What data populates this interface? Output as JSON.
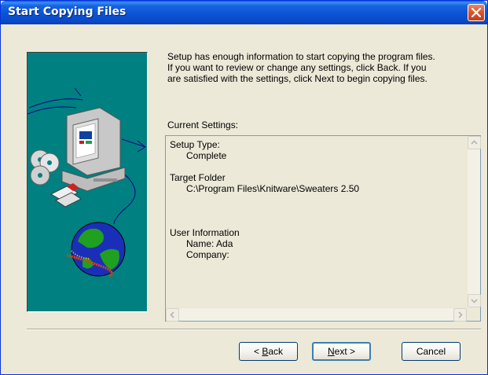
{
  "window": {
    "title": "Start Copying Files"
  },
  "intro": {
    "line1": "Setup has enough information to start copying the program files.",
    "line2": "If you want to review or change any settings, click Back.  If you",
    "line3": "are satisfied with the settings, click Next to begin copying files."
  },
  "settings": {
    "label": "Current Settings:",
    "setup_type_heading": "Setup Type:",
    "setup_type_value": "Complete",
    "target_folder_heading": "Target Folder",
    "target_folder_value": "C:\\Program Files\\Knitware\\Sweaters 2.50",
    "user_info_heading": "User Information",
    "user_name": "Name:  Ada",
    "user_company": "Company:"
  },
  "buttons": {
    "back": {
      "prefix": "< ",
      "mnemonic": "B",
      "rest": "ack"
    },
    "next": {
      "mnemonic": "N",
      "rest": "ext >"
    },
    "cancel": "Cancel"
  },
  "colors": {
    "title_bar": "#0a54d4",
    "graphic_background": "#008080",
    "dialog_background": "#ece9d8"
  }
}
